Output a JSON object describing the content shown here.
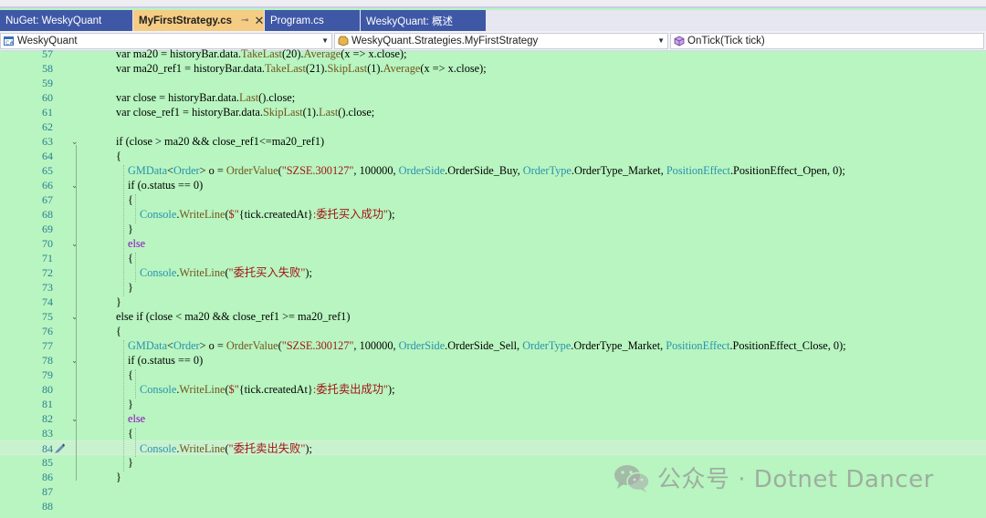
{
  "tabs": [
    {
      "label": "NuGet: WeskyQuant",
      "active": false
    },
    {
      "label": "MyFirstStrategy.cs",
      "active": true,
      "pin": "⊸",
      "close": "✕"
    },
    {
      "label": "Program.cs",
      "active": false
    },
    {
      "label": "WeskyQuant: 概述",
      "active": false
    }
  ],
  "nav": {
    "project": "WeskyQuant",
    "type": "WeskyQuant.Strategies.MyFirstStrategy",
    "member": "OnTick(Tick tick)"
  },
  "editor": {
    "current_line": "84",
    "lines": [
      {
        "n": "57",
        "tokens": [
          [
            "",
            "var ma20 = historyBar.data."
          ],
          [
            "m",
            "TakeLast"
          ],
          [
            "",
            "(20)."
          ],
          [
            "m",
            "Average"
          ],
          [
            "",
            "(x => x.close);"
          ]
        ]
      },
      {
        "n": "58",
        "tokens": [
          [
            "",
            "var ma20_ref1 = historyBar.data."
          ],
          [
            "m",
            "TakeLast"
          ],
          [
            "",
            "(21)."
          ],
          [
            "m",
            "SkipLast"
          ],
          [
            "",
            "(1)."
          ],
          [
            "m",
            "Average"
          ],
          [
            "",
            "(x => x.close);"
          ]
        ]
      },
      {
        "n": "59",
        "tokens": []
      },
      {
        "n": "60",
        "tokens": [
          [
            "",
            "var close = historyBar.data."
          ],
          [
            "m",
            "Last"
          ],
          [
            "",
            "().close;"
          ]
        ]
      },
      {
        "n": "61",
        "tokens": [
          [
            "",
            "var close_ref1 = historyBar.data."
          ],
          [
            "m",
            "SkipLast"
          ],
          [
            "",
            "(1)."
          ],
          [
            "m",
            "Last"
          ],
          [
            "",
            "().close;"
          ]
        ]
      },
      {
        "n": "62",
        "tokens": []
      },
      {
        "n": "63",
        "tokens": [
          [
            "",
            "if (close > ma20 && close_ref1<=ma20_ref1)"
          ]
        ]
      },
      {
        "n": "64",
        "tokens": [
          [
            "",
            "{"
          ]
        ]
      },
      {
        "n": "65",
        "tokens": [
          [
            "t",
            "GMData"
          ],
          [
            "",
            "<"
          ],
          [
            "t",
            "Order"
          ],
          [
            "",
            "> o = "
          ],
          [
            "m",
            "OrderValue"
          ],
          [
            "",
            "("
          ],
          [
            "s",
            "\"SZSE.300127\""
          ],
          [
            "",
            ", 100000, "
          ],
          [
            "t",
            "OrderSide"
          ],
          [
            "",
            ".OrderSide_Buy, "
          ],
          [
            "t",
            "OrderType"
          ],
          [
            "",
            ".OrderType_Market, "
          ],
          [
            "t",
            "PositionEffect"
          ],
          [
            "",
            ".PositionEffect_Open, 0);"
          ]
        ]
      },
      {
        "n": "66",
        "tokens": [
          [
            "",
            "if (o.status == 0)"
          ]
        ]
      },
      {
        "n": "67",
        "tokens": [
          [
            "",
            "{"
          ]
        ]
      },
      {
        "n": "68",
        "tokens": [
          [
            "t",
            "Console"
          ],
          [
            "",
            "."
          ],
          [
            "m",
            "WriteLine"
          ],
          [
            "",
            "("
          ],
          [
            "s",
            "$\""
          ],
          [
            "",
            "{tick.createdAt}"
          ],
          [
            "s",
            ":委托买入成功\""
          ],
          [
            "",
            ");"
          ]
        ]
      },
      {
        "n": "69",
        "tokens": [
          [
            "",
            "}"
          ]
        ]
      },
      {
        "n": "70",
        "tokens": [
          [
            "c",
            "else"
          ]
        ]
      },
      {
        "n": "71",
        "tokens": [
          [
            "",
            "{"
          ]
        ]
      },
      {
        "n": "72",
        "tokens": [
          [
            "t",
            "Console"
          ],
          [
            "",
            "."
          ],
          [
            "m",
            "WriteLine"
          ],
          [
            "",
            "("
          ],
          [
            "s",
            "\"委托买入失败\""
          ],
          [
            "",
            ");"
          ]
        ]
      },
      {
        "n": "73",
        "tokens": [
          [
            "",
            "}"
          ]
        ]
      },
      {
        "n": "74",
        "tokens": [
          [
            "",
            "}"
          ]
        ]
      },
      {
        "n": "75",
        "tokens": [
          [
            "",
            "else if (close < ma20 && close_ref1 >= ma20_ref1)"
          ]
        ]
      },
      {
        "n": "76",
        "tokens": [
          [
            "",
            "{"
          ]
        ]
      },
      {
        "n": "77",
        "tokens": [
          [
            "t",
            "GMData"
          ],
          [
            "",
            "<"
          ],
          [
            "t",
            "Order"
          ],
          [
            "",
            "> o = "
          ],
          [
            "m",
            "OrderValue"
          ],
          [
            "",
            "("
          ],
          [
            "s",
            "\"SZSE.300127\""
          ],
          [
            "",
            ", 100000, "
          ],
          [
            "t",
            "OrderSide"
          ],
          [
            "",
            ".OrderSide_Sell, "
          ],
          [
            "t",
            "OrderType"
          ],
          [
            "",
            ".OrderType_Market, "
          ],
          [
            "t",
            "PositionEffect"
          ],
          [
            "",
            ".PositionEffect_Close, 0);"
          ]
        ]
      },
      {
        "n": "78",
        "tokens": [
          [
            "",
            "if (o.status == 0)"
          ]
        ]
      },
      {
        "n": "79",
        "tokens": [
          [
            "",
            "{"
          ]
        ]
      },
      {
        "n": "80",
        "tokens": [
          [
            "t",
            "Console"
          ],
          [
            "",
            "."
          ],
          [
            "m",
            "WriteLine"
          ],
          [
            "",
            "("
          ],
          [
            "s",
            "$\""
          ],
          [
            "",
            "{tick.createdAt}"
          ],
          [
            "s",
            ":委托卖出成功\""
          ],
          [
            "",
            ");"
          ]
        ]
      },
      {
        "n": "81",
        "tokens": [
          [
            "",
            "}"
          ]
        ]
      },
      {
        "n": "82",
        "tokens": [
          [
            "c",
            "else"
          ]
        ]
      },
      {
        "n": "83",
        "tokens": [
          [
            "",
            "{"
          ]
        ]
      },
      {
        "n": "84",
        "tokens": [
          [
            "t",
            "Console"
          ],
          [
            "",
            "."
          ],
          [
            "m",
            "WriteLine"
          ],
          [
            "",
            "("
          ],
          [
            "s",
            "\"委托卖出失败\""
          ],
          [
            "",
            ");"
          ]
        ]
      },
      {
        "n": "85",
        "tokens": [
          [
            "",
            "}"
          ]
        ]
      },
      {
        "n": "86",
        "tokens": [
          [
            "",
            "}"
          ]
        ]
      },
      {
        "n": "87",
        "tokens": []
      },
      {
        "n": "88",
        "tokens": []
      }
    ]
  },
  "watermark": "公众号 · Dotnet Dancer",
  "colors": {
    "editor_bg": "#b8f5c0",
    "tab_inactive": "#3f58a6",
    "tab_active": "#f5cc84",
    "line_number": "#2b7d91",
    "type": "#2b91af",
    "method": "#74531f",
    "string": "#a31515",
    "keyword_control": "#8f08c4"
  }
}
